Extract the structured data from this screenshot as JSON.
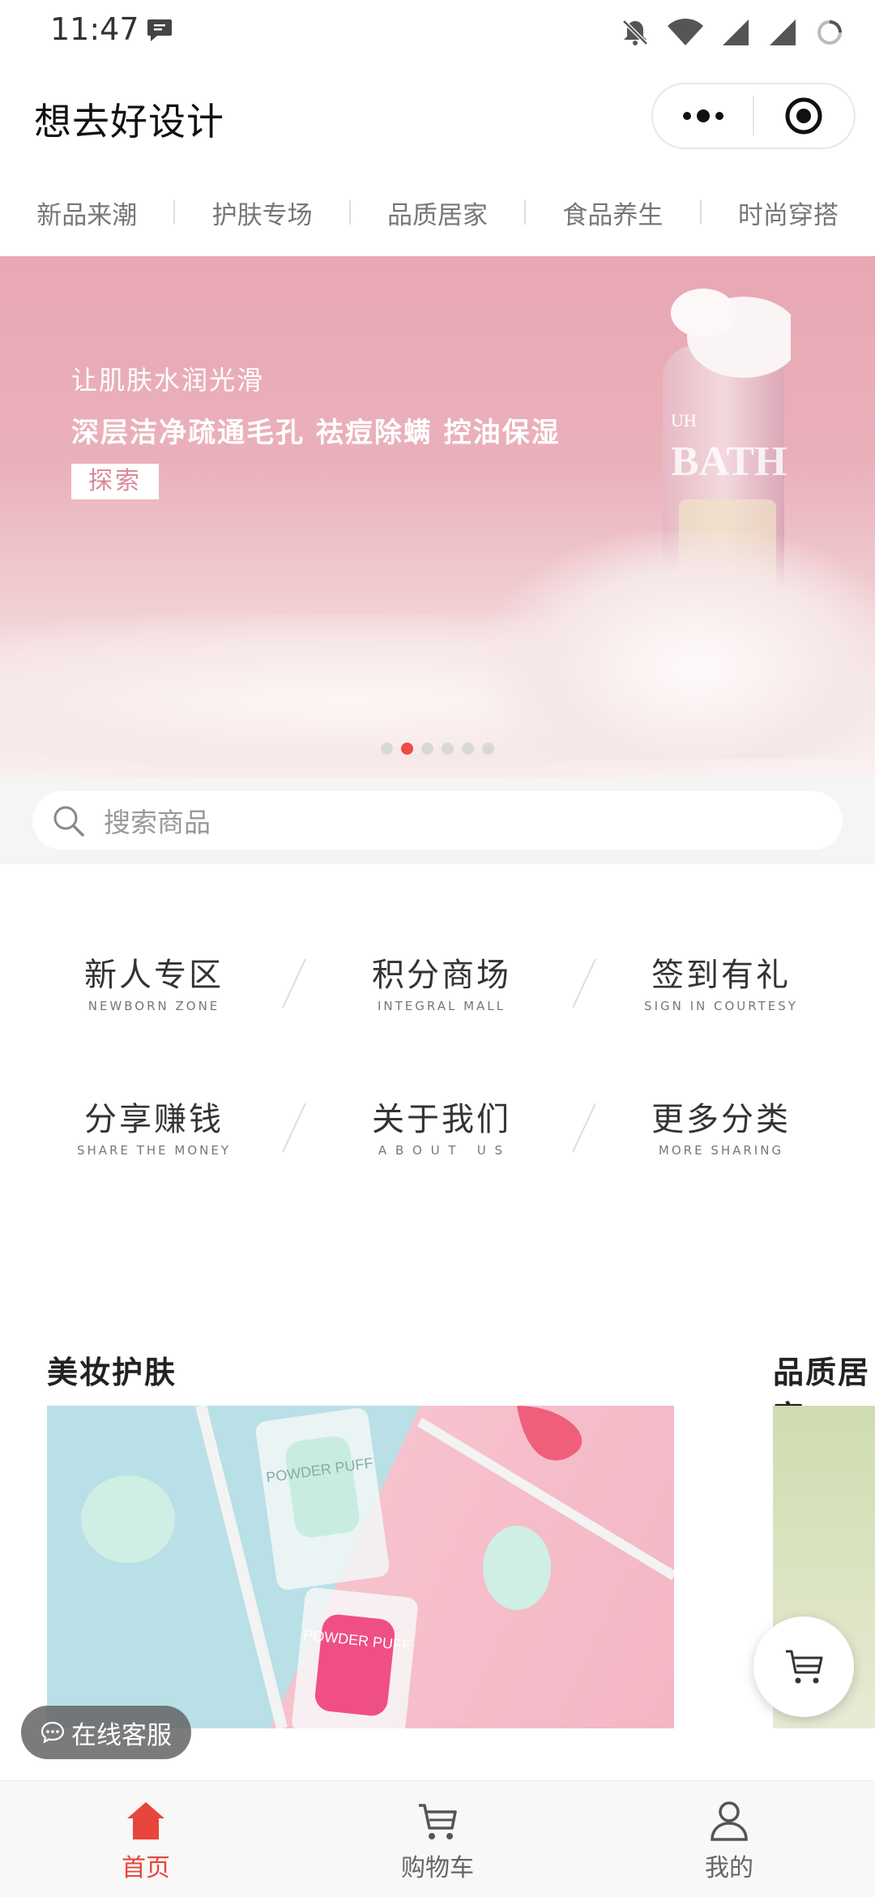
{
  "status_bar": {
    "time": "11:47"
  },
  "app": {
    "title": "想去好设计"
  },
  "category_tabs": [
    "新品来潮",
    "护肤专场",
    "品质居家",
    "食品养生",
    "时尚穿搭"
  ],
  "banner": {
    "line1": "让肌肤水润光滑",
    "line2": "深层洁净疏通毛孔 祛痘除螨 控油保湿",
    "button": "探索",
    "bottle_text": "BATH",
    "bottle_brand": "UH",
    "dots_total": 6,
    "dots_active_index": 1
  },
  "search": {
    "placeholder": "搜索商品"
  },
  "menu": [
    {
      "cn": "新人专区",
      "en": "NEWBORN ZONE"
    },
    {
      "cn": "积分商场",
      "en": "INTEGRAL MALL"
    },
    {
      "cn": "签到有礼",
      "en": "SIGN IN COURTESY"
    },
    {
      "cn": "分享赚钱",
      "en": "SHARE THE MONEY"
    },
    {
      "cn": "关于我们",
      "en": "A B O U T   U S"
    },
    {
      "cn": "更多分类",
      "en": "MORE SHARING"
    }
  ],
  "sections": [
    {
      "title": "美妆护肤",
      "image_text": "POWDER PUFF"
    },
    {
      "title": "品质居家"
    }
  ],
  "floating": {
    "service_label": "在线客服"
  },
  "tab_bar": [
    {
      "label": "首页",
      "active": true
    },
    {
      "label": "购物车",
      "active": false
    },
    {
      "label": "我的",
      "active": false
    }
  ],
  "colors": {
    "accent": "#e8453c",
    "banner_pink": "#e8a7b3",
    "dot_active": "#f04a4a"
  }
}
